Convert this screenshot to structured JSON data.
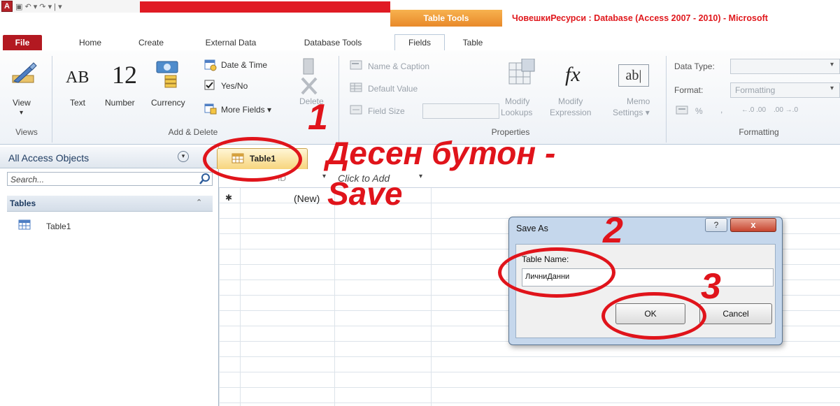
{
  "title_bar": {
    "app_icon_letter": "A",
    "quick_access_glyphs": "▣  ↶ ▾  ↷ ▾  | ▾",
    "table_tools": "Table Tools",
    "window_title": "ЧовешкиРесурси : Database (Access 2007 - 2010)  -  Microsoft"
  },
  "ribbon_tabs": [
    "File",
    "Home",
    "Create",
    "External Data",
    "Database Tools",
    "Fields",
    "Table"
  ],
  "ribbon": {
    "views": {
      "view_label": "View",
      "group": "Views"
    },
    "add_delete": {
      "text_label": "Text",
      "text_glyph": "AB",
      "number_label": "Number",
      "number_glyph": "12",
      "currency_label": "Currency",
      "date_time": "Date & Time",
      "yes_no": "Yes/No",
      "more_fields": "More Fields ▾",
      "delete": "Delete",
      "group": "Add & Delete"
    },
    "properties": {
      "name_caption": "Name & Caption",
      "default_value": "Default Value",
      "field_size": "Field Size",
      "modify_lookups_1": "Modify",
      "modify_lookups_2": "Lookups",
      "modify_expression_1": "Modify",
      "modify_expression_2": "Expression",
      "memo_settings_1": "Memo",
      "memo_settings_2": "Settings ▾",
      "fx_glyph": "fx",
      "ab_glyph": "ab|",
      "group": "Properties"
    },
    "formatting": {
      "data_type_label": "Data Type:",
      "format_label": "Format:",
      "format_value": "Formatting",
      "percent": "%",
      "comma": ",",
      "dec_inc": "←.0 .00",
      "dec_dec": ".00 →.0",
      "group": "Formatting"
    }
  },
  "nav_pane": {
    "header": "All Access Objects",
    "search_placeholder": "Search...",
    "section": "Tables",
    "items": [
      "Table1"
    ]
  },
  "document": {
    "tab_label": "Table1",
    "columns": [
      "ID",
      "Click to Add"
    ],
    "new_row_marker": "✱",
    "new_row_value": "(New)"
  },
  "dialog": {
    "title": "Save As",
    "field_label": "Table Name:",
    "field_value": "ЛичниДанни",
    "ok": "OK",
    "cancel": "Cancel",
    "help_glyph": "?",
    "close_glyph": "x"
  },
  "annotations": {
    "step1": "1",
    "step2": "2",
    "step3": "3",
    "line1": "Десен бутон -",
    "line2": "Save"
  },
  "colors": {
    "annotation_red": "#e0141b",
    "file_tab": "#b31921",
    "table_tools_orange": "#f4a03c",
    "dialog_frame": "#c5d7ec"
  }
}
